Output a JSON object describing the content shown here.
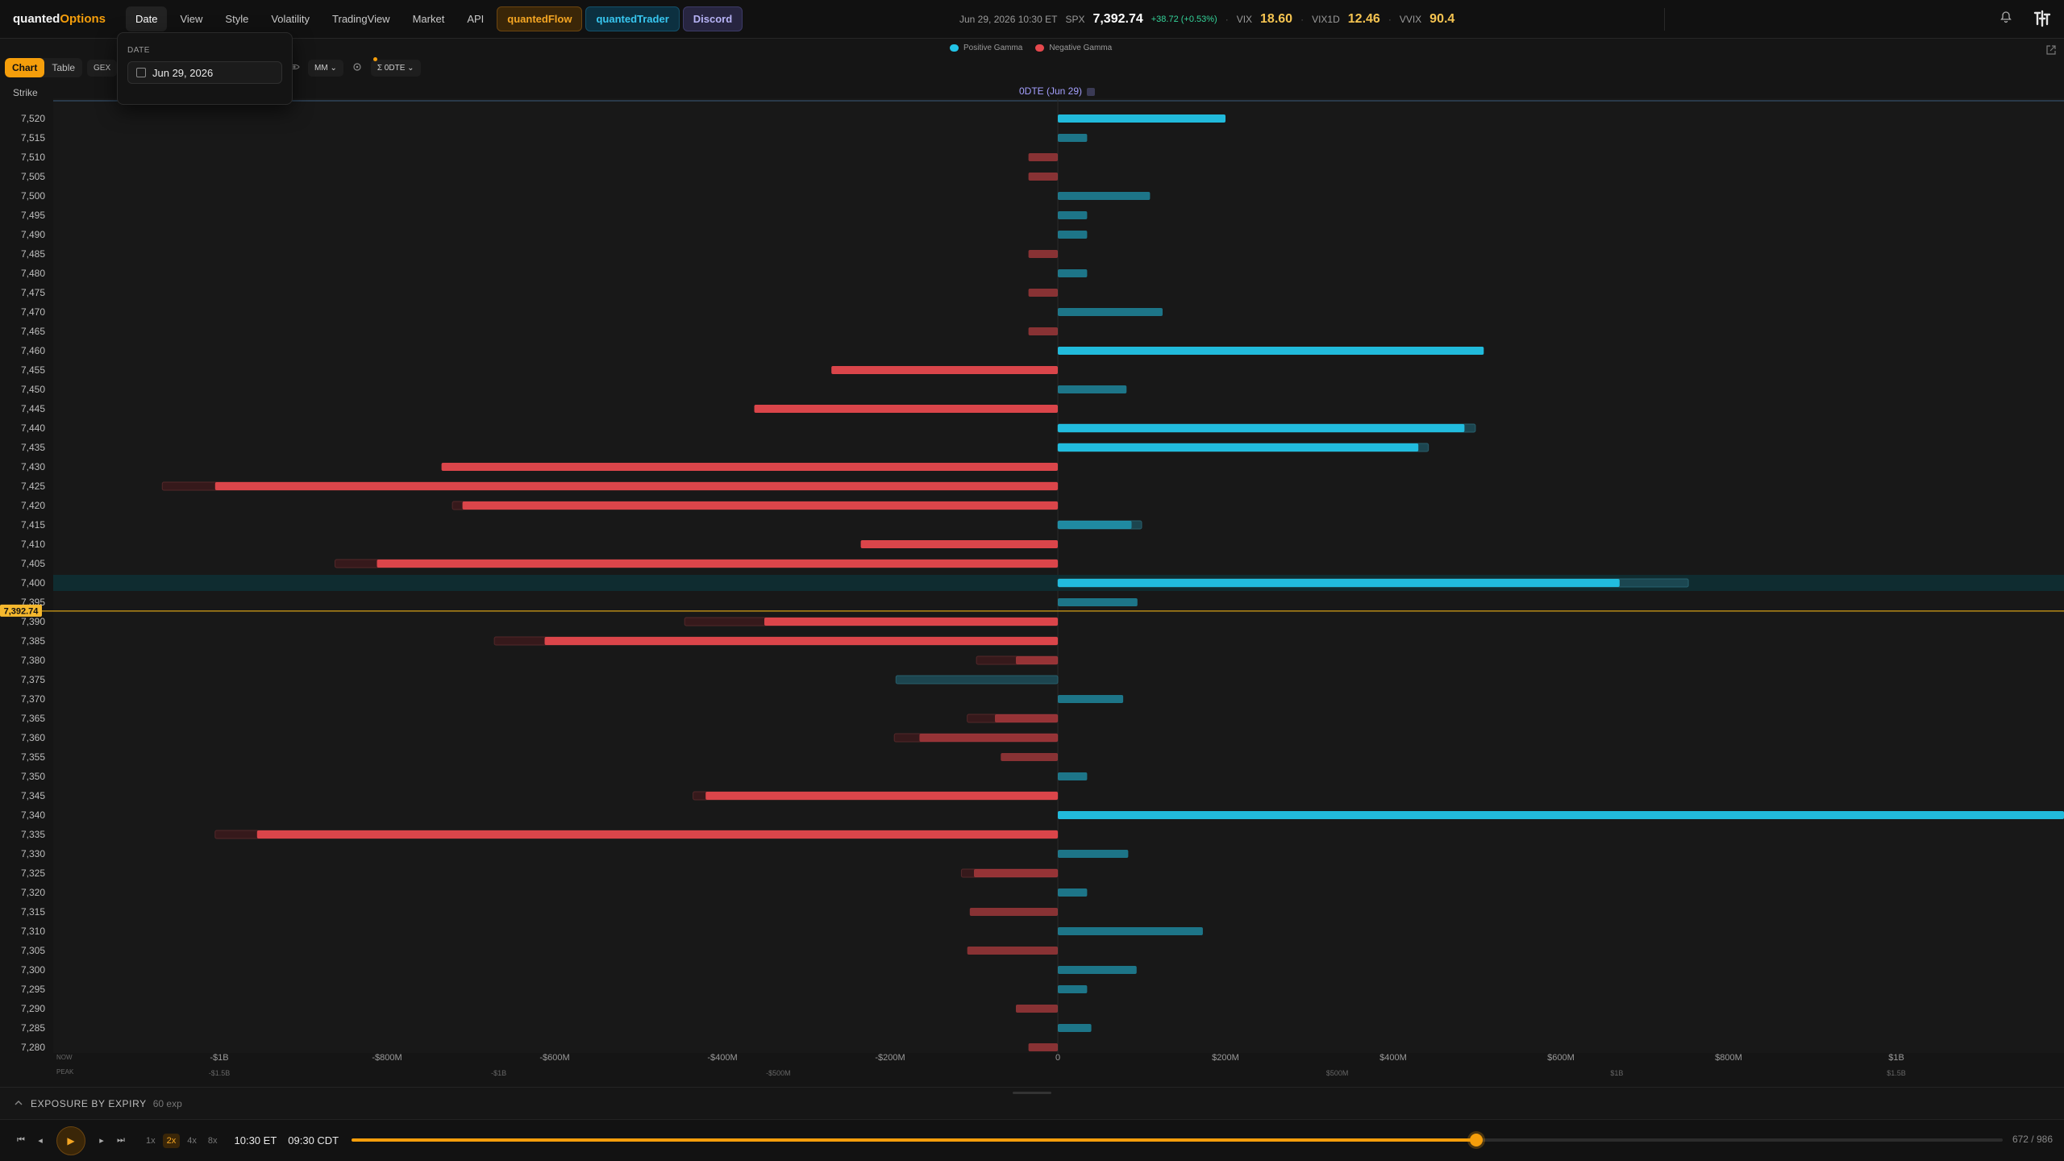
{
  "app": {
    "logo_prefix": "quanted",
    "logo_suffix": "Options"
  },
  "nav": {
    "items": [
      "Date",
      "View",
      "Style",
      "Volatility",
      "TradingView",
      "Market",
      "API"
    ],
    "active": "Date",
    "flow": "quantedFlow",
    "trader": "quantedTrader",
    "discord": "Discord"
  },
  "quotes": {
    "datetime": "Jun 29, 2026 10:30 ET",
    "spx_label": "SPX",
    "spx_value": "7,392.74",
    "spx_change": "+38.72 (+0.53%)",
    "vix_label": "VIX",
    "vix_value": "18.60",
    "vix1d_label": "VIX1D",
    "vix1d_value": "12.46",
    "vvix_label": "VVIX",
    "vvix_value": "90.4"
  },
  "date_popover": {
    "label": "DATE",
    "value": "Jun 29, 2026"
  },
  "legend": {
    "positive": "Positive Gamma",
    "negative": "Negative Gamma",
    "positive_color": "#22c3e6",
    "negative_color": "#e5484d"
  },
  "toolbar": {
    "chart": "Chart",
    "table": "Table",
    "gex": "GEX",
    "mm": "MM",
    "dte": "Σ 0DTE"
  },
  "chart_header": {
    "strike": "Strike",
    "expiry": "0DTE (Jun 29)",
    "spot_label": "7,392.74",
    "spot": 7392.74
  },
  "chart_data": {
    "type": "bar",
    "orientation": "horizontal",
    "xlim": [
      -1200,
      1200
    ],
    "x_unit": "M",
    "strikes": [
      7520,
      7515,
      7510,
      7505,
      7500,
      7495,
      7490,
      7485,
      7480,
      7475,
      7470,
      7465,
      7460,
      7455,
      7450,
      7445,
      7440,
      7435,
      7430,
      7425,
      7420,
      7415,
      7410,
      7405,
      7400,
      7395,
      7390,
      7385,
      7380,
      7375,
      7370,
      7365,
      7360,
      7355,
      7350,
      7345,
      7340,
      7335,
      7330,
      7325,
      7320,
      7315,
      7310,
      7305,
      7300,
      7295,
      7290,
      7285,
      7280
    ],
    "now": [
      200,
      35,
      -35,
      -35,
      110,
      35,
      35,
      -35,
      35,
      -35,
      125,
      -35,
      508,
      -270,
      82,
      -362,
      485,
      430,
      -735,
      -1005,
      -710,
      88,
      -235,
      -812,
      670,
      95,
      -350,
      -612,
      -50,
      0,
      78,
      -75,
      -165,
      -68,
      35,
      -420,
      1200,
      -955,
      84,
      -100,
      35,
      -105,
      173,
      -108,
      94,
      35,
      -50,
      40,
      -35
    ],
    "peak": [
      0,
      0,
      0,
      0,
      0,
      0,
      0,
      0,
      0,
      0,
      0,
      0,
      0,
      0,
      0,
      0,
      498,
      442,
      0,
      -1068,
      -722,
      100,
      0,
      -862,
      752,
      0,
      -445,
      -672,
      -97,
      -193,
      0,
      -108,
      -195,
      0,
      0,
      -435,
      0,
      -1005,
      0,
      -115,
      0,
      0,
      0,
      0,
      0,
      0,
      0,
      0,
      0
    ],
    "now_ticks": [
      "-$1B",
      "-$800M",
      "-$600M",
      "-$400M",
      "-$200M",
      "0",
      "$200M",
      "$400M",
      "$600M",
      "$800M",
      "$1B"
    ],
    "now_tick_values": [
      -1000,
      -800,
      -600,
      -400,
      -200,
      0,
      200,
      400,
      600,
      800,
      1000
    ],
    "peak_ticks": [
      "-$1.5B",
      "-$1B",
      "-$500M",
      "$500M",
      "$1B",
      "$1.5B"
    ],
    "peak_tick_values": [
      -1500,
      -1000,
      -500,
      500,
      1000,
      1500
    ],
    "peak_scale": 1.5,
    "row_now": "NOW",
    "row_peak": "PEAK"
  },
  "expiry_panel": {
    "title": "EXPOSURE BY EXPIRY",
    "count": "60 exp"
  },
  "player": {
    "speeds": [
      "1x",
      "2x",
      "4x",
      "8x"
    ],
    "active_speed": "2x",
    "time_et": "10:30 ET",
    "time_cdt": "09:30 CDT",
    "frame": "672 / 986",
    "progress": 0.681
  }
}
